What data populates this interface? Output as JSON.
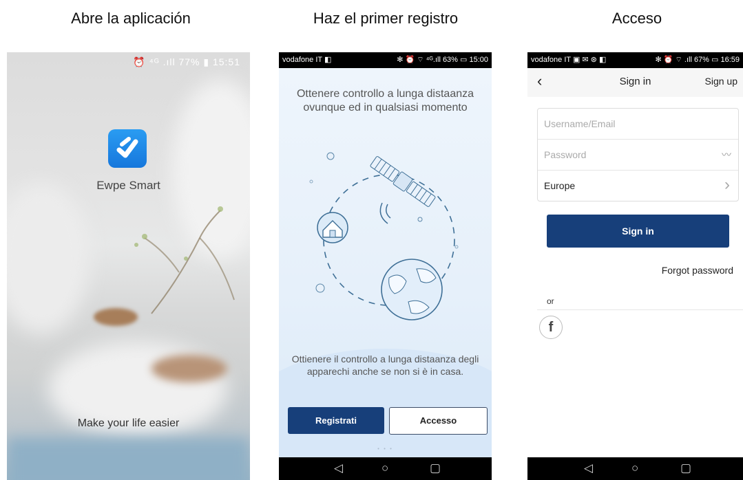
{
  "captions": [
    "Abre la aplicación",
    "Haz el primer registro",
    "Acceso"
  ],
  "screen1": {
    "status_text": "⏰ ⁴ᴳ .ıll 77% ▮ 15:51",
    "app_name": "Ewpe Smart",
    "tagline": "Make your life easier"
  },
  "screen2": {
    "status_left": "vodafone IT ◧",
    "status_right": "✻ ⏰ ⌔ ⁴ᴳ.ıll 63% ▭ 15:00",
    "headline": "Ottenere controllo a lunga distaanza ovunque ed in qualsiasi momento",
    "subtext": "Ottienere il controllo a lunga distaanza degli apparechi anche se non si è in casa.",
    "register_button": "Registrati",
    "access_button": "Accesso",
    "dots": "•  •  •",
    "nav": {
      "back": "◁",
      "home": "○",
      "recent": "▢"
    }
  },
  "screen3": {
    "status_left": "vodafone IT ▣ ✉ ⊛ ◧",
    "status_right": "✻ ⏰ ⌔ .ıll 67% ▭ 16:59",
    "back_icon": "‹",
    "title": "Sign in",
    "signup_label": "Sign up",
    "username_placeholder": "Username/Email",
    "password_placeholder": "Password",
    "eye_icon": "〰",
    "region": "Europe",
    "chevron": "›",
    "signin_button": "Sign in",
    "forgot_label": "Forgot password",
    "or_label": "or",
    "facebook_glyph": "f",
    "nav": {
      "back": "◁",
      "home": "○",
      "recent": "▢"
    }
  },
  "colors": {
    "primary": "#173f7a",
    "logo": "#1e88e5"
  }
}
